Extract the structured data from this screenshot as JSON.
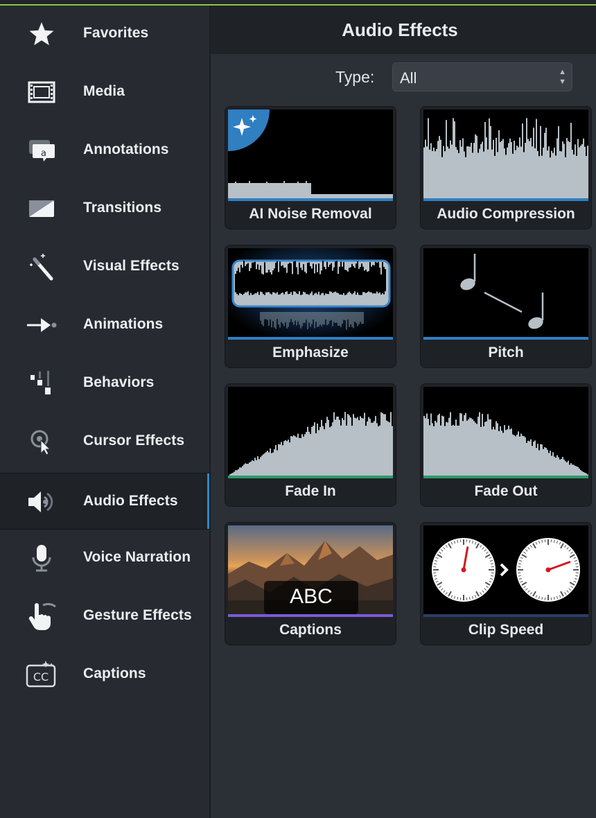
{
  "sidebar": {
    "items": [
      {
        "label": "Favorites",
        "icon": "star-icon"
      },
      {
        "label": "Media",
        "icon": "film-icon"
      },
      {
        "label": "Annotations",
        "icon": "annotation-icon"
      },
      {
        "label": "Transitions",
        "icon": "transition-icon"
      },
      {
        "label": "Visual Effects",
        "icon": "magic-wand-icon"
      },
      {
        "label": "Animations",
        "icon": "animation-arrow-icon"
      },
      {
        "label": "Behaviors",
        "icon": "behaviors-icon"
      },
      {
        "label": "Cursor Effects",
        "icon": "cursor-effects-icon"
      },
      {
        "label": "Audio Effects",
        "icon": "speaker-icon",
        "active": true
      },
      {
        "label": "Voice Narration",
        "icon": "microphone-icon"
      },
      {
        "label": "Gesture Effects",
        "icon": "gesture-hand-icon"
      },
      {
        "label": "Captions",
        "icon": "closed-caption-icon"
      }
    ]
  },
  "panel": {
    "title": "Audio Effects",
    "type_label": "Type:",
    "type_value": "All"
  },
  "tiles": [
    {
      "label": "AI Noise Removal",
      "accent": "#2f7fc1"
    },
    {
      "label": "Audio Compression",
      "accent": "#2f7fc1"
    },
    {
      "label": "Emphasize",
      "accent": "#2f7fc1"
    },
    {
      "label": "Pitch",
      "accent": "#2f7fc1"
    },
    {
      "label": "Fade In",
      "accent": "#2f9a6a"
    },
    {
      "label": "Fade Out",
      "accent": "#2f9a6a"
    },
    {
      "label": "Captions",
      "accent": "#7a5bd6",
      "overlay_text": "ABC"
    },
    {
      "label": "Clip Speed",
      "accent": "#2a3f66"
    }
  ],
  "colors": {
    "accent_line": "#8cc63f",
    "active_bar": "#2f86c9",
    "waveform": "#b7c0c7"
  }
}
